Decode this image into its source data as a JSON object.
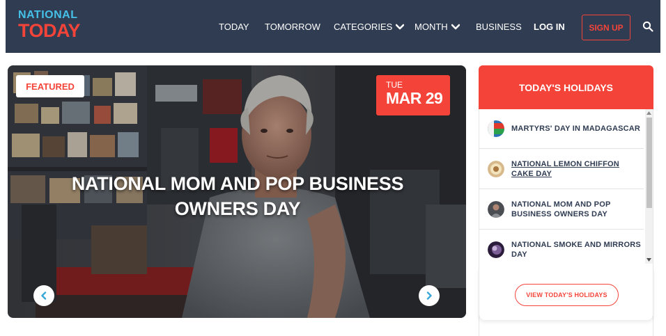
{
  "brand": {
    "line1": "NATIONAL",
    "line2": "TODAY",
    "color_blue": "#45c1e8",
    "color_red": "#f4443a"
  },
  "nav": {
    "today": "TODAY",
    "tomorrow": "TOMORROW",
    "categories": "CATEGORIES",
    "month": "MONTH",
    "business": "BUSINESS",
    "login": "LOG IN",
    "signup": "SIGN UP",
    "search_icon": "search-icon"
  },
  "hero": {
    "badge": "FEATURED",
    "date_dow": "TUE",
    "date_day": "MAR 29",
    "title": "NATIONAL MOM AND POP BUSINESS OWNERS DAY",
    "prev_icon": "chevron-left-icon",
    "next_icon": "chevron-right-icon"
  },
  "sidebar": {
    "heading": "TODAY'S HOLIDAYS",
    "items": [
      {
        "label": "MARTYRS' DAY IN MADAGASCAR",
        "icon": "madagascar-flag-thumbnail"
      },
      {
        "label": "NATIONAL LEMON CHIFFON CAKE DAY",
        "icon": "cake-thumbnail"
      },
      {
        "label": "NATIONAL MOM AND POP BUSINESS OWNERS DAY",
        "icon": "shop-owner-thumbnail"
      },
      {
        "label": "NATIONAL SMOKE AND MIRRORS DAY",
        "icon": "smoke-thumbnail"
      }
    ],
    "button": "VIEW TODAY'S HOLIDAYS"
  },
  "colors": {
    "header_bg": "#2f3c52",
    "accent": "#f4443a",
    "arrow_icon": "#3aa7d9"
  }
}
